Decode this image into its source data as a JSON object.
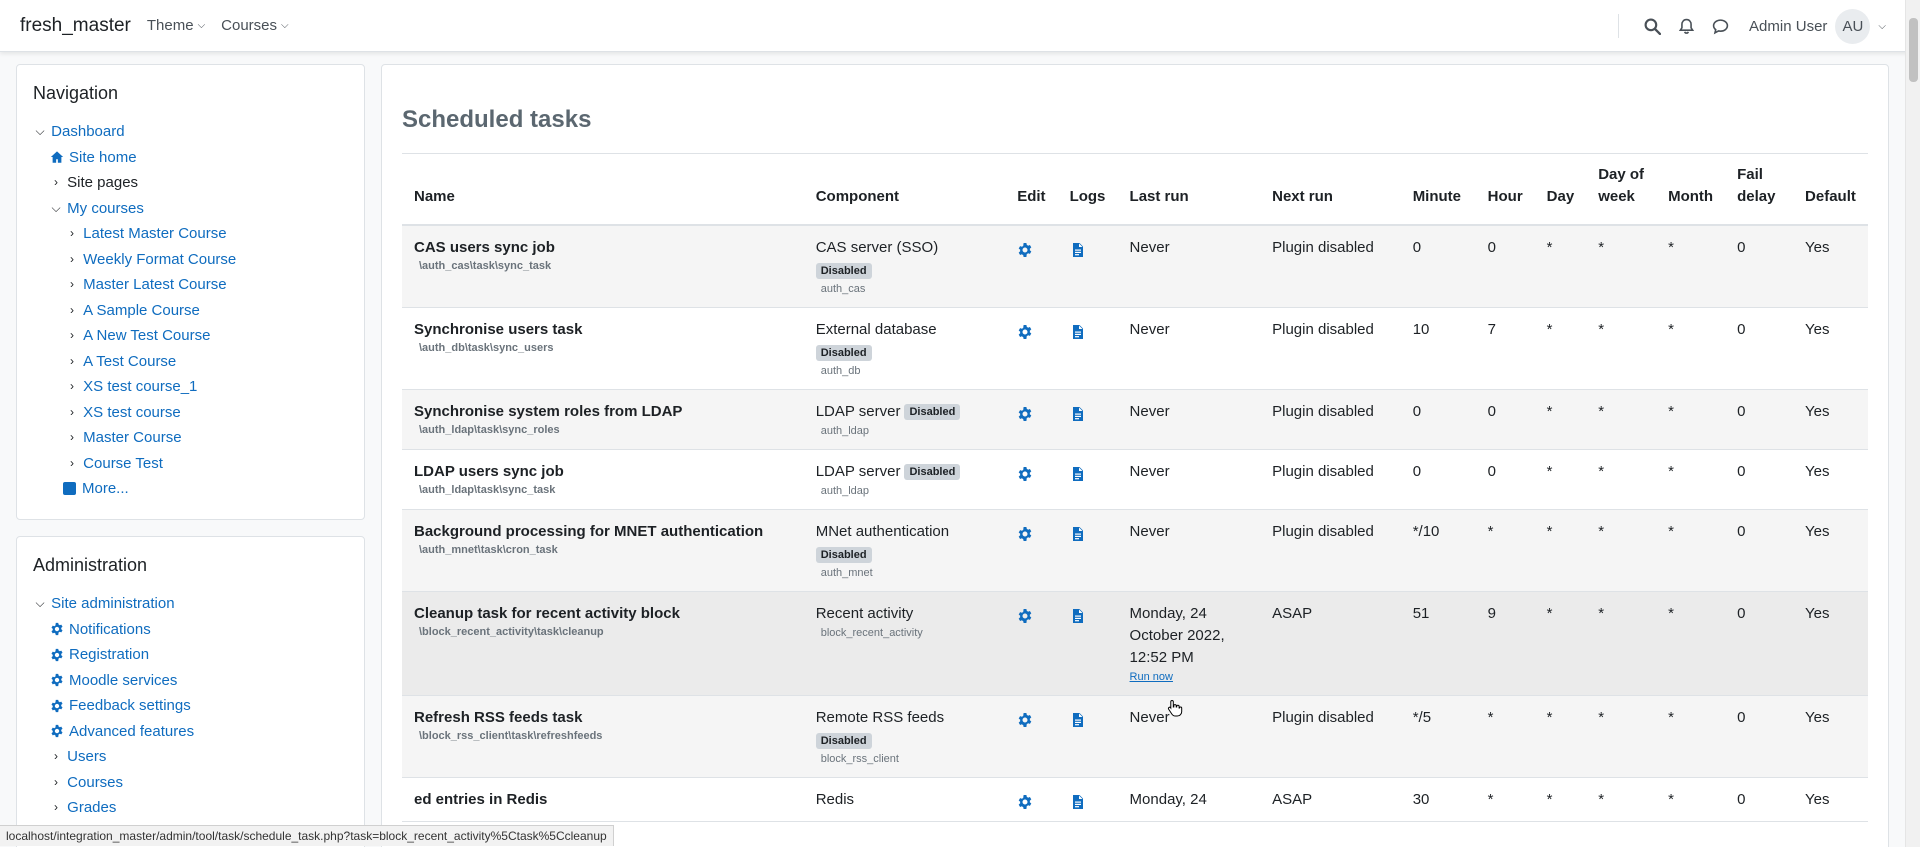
{
  "header": {
    "brand": "fresh_master",
    "menus": [
      {
        "label": "Theme"
      },
      {
        "label": "Courses"
      }
    ],
    "user_name": "Admin User",
    "avatar_initials": "AU"
  },
  "navigation": {
    "title": "Navigation",
    "dashboard": "Dashboard",
    "site_home": "Site home",
    "site_pages": "Site pages",
    "my_courses": "My courses",
    "courses": [
      "Latest Master Course",
      "Weekly Format Course",
      "Master Latest Course",
      "A Sample Course",
      "A New Test Course",
      "A Test Course",
      "XS test course_1",
      "XS test course",
      "Master Course",
      "Course Test"
    ],
    "more": "More..."
  },
  "administration": {
    "title": "Administration",
    "site_admin": "Site administration",
    "items": [
      "Notifications",
      "Registration",
      "Moodle services",
      "Feedback settings",
      "Advanced features"
    ],
    "sub": [
      "Users",
      "Courses",
      "Grades"
    ]
  },
  "page": {
    "title": "Scheduled tasks",
    "columns": [
      "Name",
      "Component",
      "Edit",
      "Logs",
      "Last run",
      "Next run",
      "Minute",
      "Hour",
      "Day",
      "Day of week",
      "Month",
      "Fail delay",
      "Default"
    ],
    "disabled_badge": "Disabled",
    "run_now": "Run now",
    "rows": [
      {
        "name": "CAS users sync job",
        "class": "\\auth_cas\\task\\sync_task",
        "component": "CAS server (SSO)",
        "disabled": true,
        "badge_inline": false,
        "comp_id": "auth_cas",
        "last_run": "Never",
        "next_run": "Plugin disabled",
        "minute": "0",
        "hour": "0",
        "day": "*",
        "dow": "*",
        "month": "*",
        "fail": "0",
        "default": "Yes"
      },
      {
        "name": "Synchronise users task",
        "class": "\\auth_db\\task\\sync_users",
        "component": "External database",
        "disabled": true,
        "badge_inline": false,
        "comp_id": "auth_db",
        "last_run": "Never",
        "next_run": "Plugin disabled",
        "minute": "10",
        "hour": "7",
        "day": "*",
        "dow": "*",
        "month": "*",
        "fail": "0",
        "default": "Yes"
      },
      {
        "name": "Synchronise system roles from LDAP",
        "class": "\\auth_ldap\\task\\sync_roles",
        "component": "LDAP server",
        "disabled": true,
        "badge_inline": true,
        "comp_id": "auth_ldap",
        "last_run": "Never",
        "next_run": "Plugin disabled",
        "minute": "0",
        "hour": "0",
        "day": "*",
        "dow": "*",
        "month": "*",
        "fail": "0",
        "default": "Yes"
      },
      {
        "name": "LDAP users sync job",
        "class": "\\auth_ldap\\task\\sync_task",
        "component": "LDAP server",
        "disabled": true,
        "badge_inline": true,
        "comp_id": "auth_ldap",
        "last_run": "Never",
        "next_run": "Plugin disabled",
        "minute": "0",
        "hour": "0",
        "day": "*",
        "dow": "*",
        "month": "*",
        "fail": "0",
        "default": "Yes"
      },
      {
        "name": "Background processing for MNET authentication",
        "class": "\\auth_mnet\\task\\cron_task",
        "component": "MNet authentication",
        "disabled": true,
        "badge_inline": false,
        "comp_id": "auth_mnet",
        "last_run": "Never",
        "next_run": "Plugin disabled",
        "minute": "*/10",
        "hour": "*",
        "day": "*",
        "dow": "*",
        "month": "*",
        "fail": "0",
        "default": "Yes"
      },
      {
        "name": "Cleanup task for recent activity block",
        "class": "\\block_recent_activity\\task\\cleanup",
        "component": "Recent activity",
        "disabled": false,
        "badge_inline": false,
        "comp_id": "block_recent_activity",
        "last_run": "Monday, 24 October 2022, 12:52 PM",
        "run_now": true,
        "next_run": "ASAP",
        "minute": "51",
        "hour": "9",
        "day": "*",
        "dow": "*",
        "month": "*",
        "fail": "0",
        "default": "Yes"
      },
      {
        "name": "Refresh RSS feeds task",
        "class": "\\block_rss_client\\task\\refreshfeeds",
        "component": "Remote RSS feeds",
        "disabled": true,
        "badge_inline": false,
        "comp_id": "block_rss_client",
        "last_run": "Never",
        "next_run": "Plugin disabled",
        "minute": "*/5",
        "hour": "*",
        "day": "*",
        "dow": "*",
        "month": "*",
        "fail": "0",
        "default": "Yes"
      },
      {
        "name": "ed entries in Redis",
        "class": "",
        "component": "Redis",
        "disabled": false,
        "badge_inline": false,
        "comp_id": "",
        "last_run": "Monday, 24",
        "next_run": "ASAP",
        "minute": "30",
        "hour": "*",
        "day": "*",
        "dow": "*",
        "month": "*",
        "fail": "0",
        "default": "Yes"
      }
    ]
  },
  "statusbar": {
    "url": "localhost/integration_master/admin/tool/task/schedule_task.php?task=block_recent_activity%5Ctask%5Ccleanup"
  },
  "colors": {
    "link": "#0f6cbf",
    "badge": "#ced4da",
    "row_stripe": "#f5f5f5",
    "row_hover": "#ebebeb"
  },
  "icons": {
    "edit": "gear-icon",
    "logs": "file-icon",
    "search": "search-icon",
    "notifications": "bell-icon",
    "messages": "chat-icon"
  }
}
